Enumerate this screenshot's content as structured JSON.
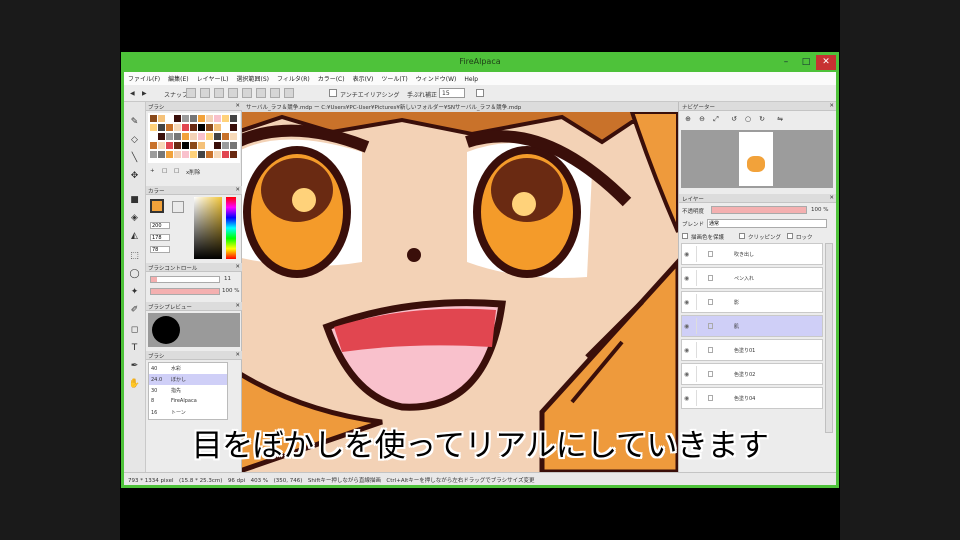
{
  "app": {
    "title": "FireAlpaca",
    "window_controls": [
      "–",
      "□",
      "✕"
    ],
    "accent": "#4ec23a"
  },
  "menu": [
    "ファイル(F)",
    "編集(E)",
    "レイヤー(L)",
    "選択範囲(S)",
    "フィルタ(R)",
    "カラー(C)",
    "表示(V)",
    "ツール(T)",
    "ウィンドウ(W)",
    "Help"
  ],
  "toolbar": {
    "snap_label": "スナップ",
    "antialias_label": "アンチエイリアシング",
    "correction_label": "手ぶれ補正",
    "correction_value": "15"
  },
  "panels": {
    "brush_palette": "ブラシ",
    "palette_buttons": [
      "+",
      "□",
      "□",
      "x削除"
    ],
    "color": "カラー",
    "color_fields": [
      "200",
      "178",
      "78"
    ],
    "brush_control": "ブラシコントロール",
    "brush_size": "11",
    "brush_opacity": "100 %",
    "brush_preview": "ブラシプレビュー",
    "brush_list": "ブラシ",
    "brushes": [
      {
        "size": "40",
        "name": "水彩"
      },
      {
        "size": "24.0",
        "name": "ぼかし"
      },
      {
        "size": "30",
        "name": "指先"
      },
      {
        "size": "8",
        "name": "FireAlpaca"
      },
      {
        "size": "16",
        "name": "トーン"
      }
    ]
  },
  "tabs": "サーバル_ラフ＆競争.mdp ー C:¥Users¥PC-User¥Pictures¥新しいフォルダー¥SNサーバル_ラフ＆競争.mdp",
  "navigator": {
    "title": "ナビゲーター",
    "icons": [
      "zoom-in",
      "zoom-out",
      "fit",
      "rotate-left",
      "reset",
      "rotate-right",
      "flip"
    ]
  },
  "layers": {
    "title": "レイヤー",
    "opacity_label": "不透明度",
    "opacity_value": "100 %",
    "blend_label": "ブレンド",
    "blend_value": "通常",
    "checkbox_labels": [
      "描画色を保護",
      "クリッピング",
      "ロック"
    ],
    "items": [
      {
        "name": "吹き出し",
        "selected": false
      },
      {
        "name": "ペン入れ",
        "selected": false
      },
      {
        "name": "影",
        "selected": false
      },
      {
        "name": "肌",
        "selected": true
      },
      {
        "name": "色塗り01",
        "selected": false
      },
      {
        "name": "色塗り02",
        "selected": false
      },
      {
        "name": "色塗り04",
        "selected": false
      }
    ]
  },
  "status": "793 * 1334 pixel　(15.8 * 25.3cm)　96 dpi　403 %　(350, 746)　Shiftキー押しながら直線描画　Ctrl+Altキーを押しながら左右ドラッグでブラシサイズ変更",
  "subtitle": "目をぼかしを使ってリアルにしていきます"
}
